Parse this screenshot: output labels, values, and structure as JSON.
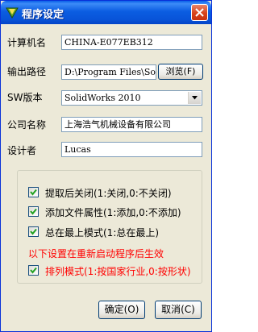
{
  "window": {
    "title": "程序设定"
  },
  "fields": {
    "computer_name": {
      "label": "计算机名",
      "value": "CHINA-E077EB312"
    },
    "output_path": {
      "label": "输出路径",
      "value": "D:\\Program Files\\SolidWorks",
      "browse_label": "浏览(F)"
    },
    "sw_version": {
      "label": "SW版本",
      "value": "SolidWorks 2010"
    },
    "company": {
      "label": "公司名称",
      "value": "上海浩气机械设备有限公司"
    },
    "designer": {
      "label": "设计者",
      "value": "Lucas"
    }
  },
  "options": [
    {
      "label": "提取后关闭(1:关闭,0:不关闭)",
      "checked": true
    },
    {
      "label": "添加文件属性(1:添加,0:不添加)",
      "checked": true
    },
    {
      "label": "总在最上模式(1:总在最上)",
      "checked": true
    }
  ],
  "restart_note": "以下设置在重新启动程序后生效",
  "arrange_option": {
    "label": "排列模式(1:按国家行业,0:按形状)",
    "checked": true
  },
  "buttons": {
    "ok": "确定(O)",
    "cancel": "取消(C)"
  },
  "colors": {
    "titlebar": "#0a5ee8",
    "window_bg": "#ece9d8",
    "note": "#ff0000"
  }
}
